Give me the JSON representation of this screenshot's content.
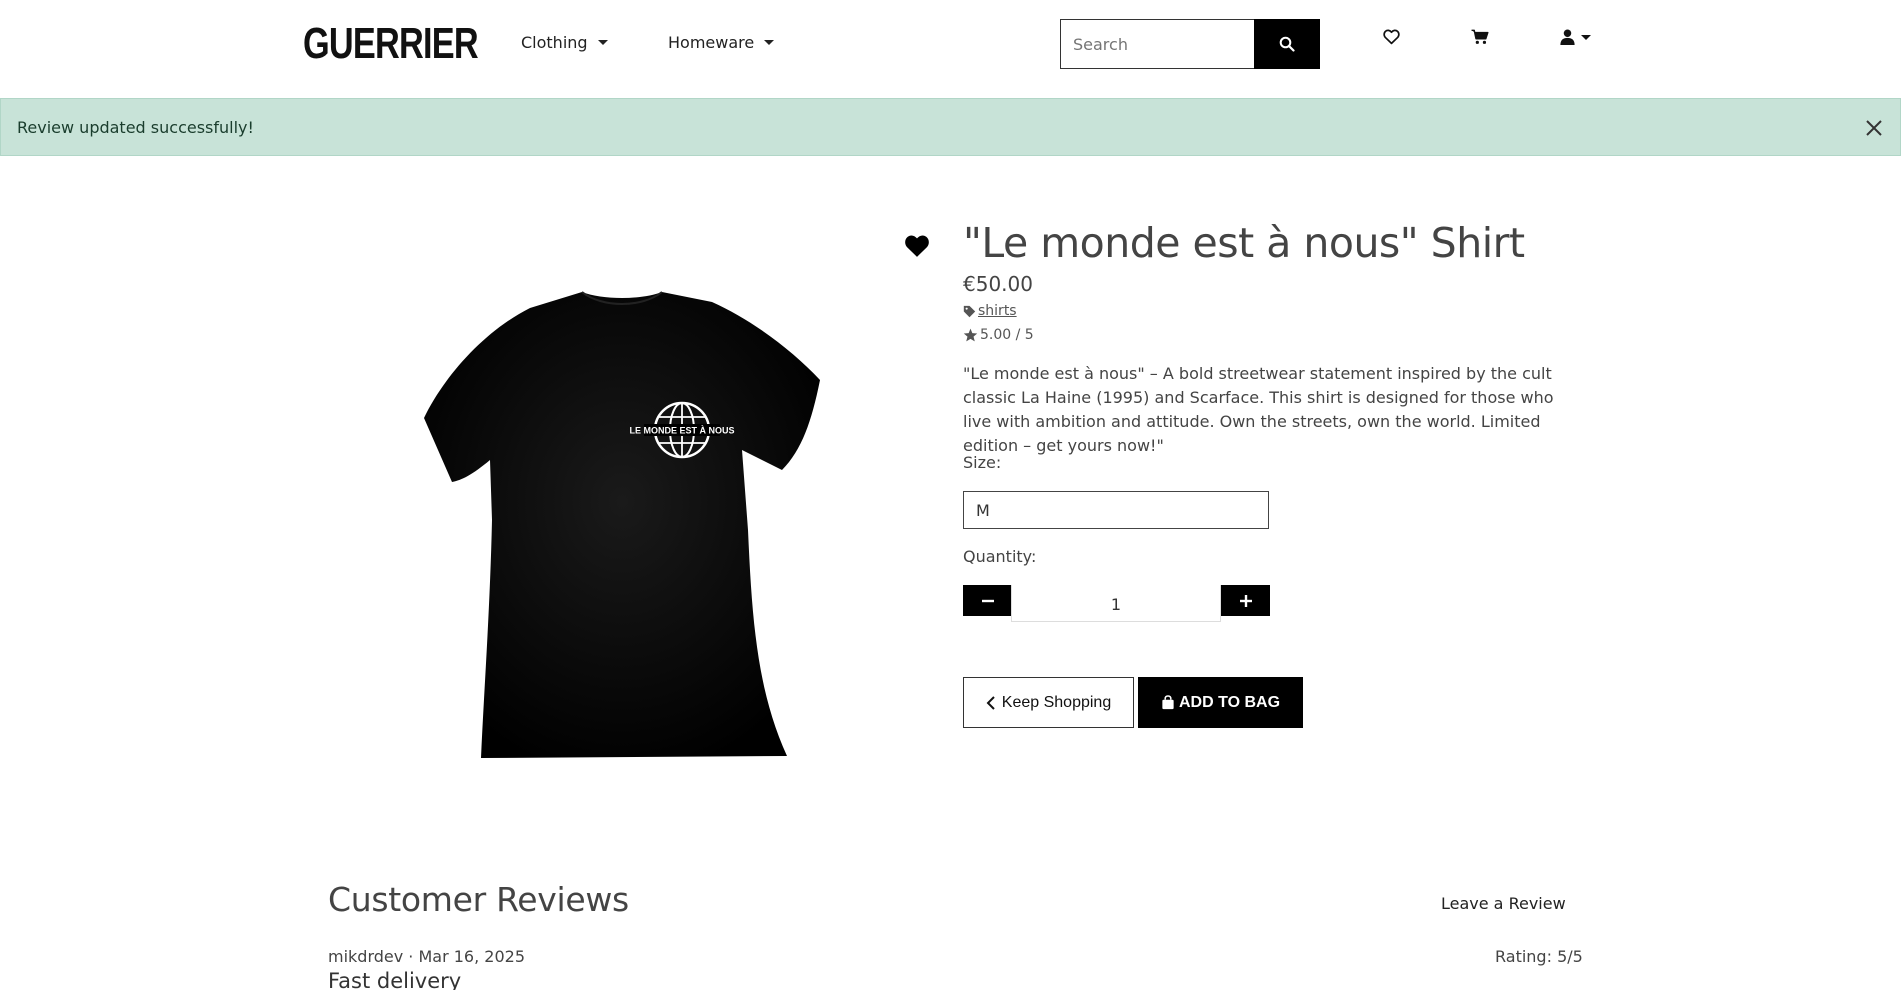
{
  "navbar": {
    "brand": "GUERRIER",
    "menu": [
      {
        "label": "Clothing"
      },
      {
        "label": "Homeware"
      }
    ],
    "search_placeholder": "Search"
  },
  "alert": {
    "message": "Review updated successfully!"
  },
  "product": {
    "title": "\"Le monde est à nous\" Shirt",
    "price": "€50.00",
    "category": "shirts",
    "rating": "5.00 / 5",
    "description": "\"Le monde est à nous\" – A bold streetwear statement inspired by the cult classic La Haine (1995) and Scarface. This shirt is designed for those who live with ambition and attitude. Own the streets, own the world. Limited edition – get yours now!\"",
    "print_text": "LE MONDE EST À NOUS",
    "size_label": "Size:",
    "size_value": "M",
    "quantity_label": "Quantity:",
    "quantity_value": "1",
    "keep_shopping_label": "Keep Shopping",
    "add_to_bag_label": "ADD TO BAG"
  },
  "reviews": {
    "title": "Customer Reviews",
    "leave_review_label": "Leave a Review",
    "items": [
      {
        "meta": "mikdrdev · Mar 16, 2025",
        "rating": "Rating: 5/5",
        "title": "Fast delivery"
      }
    ]
  }
}
